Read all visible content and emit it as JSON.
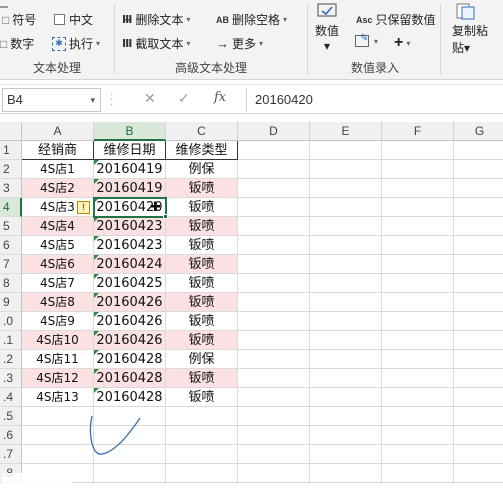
{
  "ribbon": {
    "row1": {
      "symbol": "符号",
      "chinese": "中文",
      "delete_text": "删除文本",
      "delete_spaces": "删除空格"
    },
    "row2": {
      "number": "数字",
      "execute": "执行",
      "extract_text": "截取文本",
      "more": "更多"
    },
    "numeric_btn": "数值",
    "keep_numeric": "只保留数值",
    "paste_line1": "复制粘",
    "paste_line2": "贴",
    "group_labels": [
      "文本处理",
      "高级文本处理",
      "数值录入"
    ],
    "asc_label": "Asc",
    "ab_label": "AB",
    "plus_label": "+"
  },
  "formula_bar": {
    "name_box": "B4",
    "cancel": "✕",
    "confirm": "✓",
    "fx": "fx",
    "content": "20160420"
  },
  "sheet": {
    "columns": [
      "A",
      "B",
      "C",
      "D",
      "E",
      "F",
      "G"
    ],
    "row_numbers": [
      "1",
      "2",
      "3",
      "4",
      "5",
      "6",
      "7",
      "8",
      "9",
      ".0",
      ".1",
      ".2",
      ".3",
      ".4",
      ".5",
      ".6",
      ".7",
      ".8"
    ],
    "header": [
      "经销商",
      "维修日期",
      "维修类型"
    ],
    "rows": [
      [
        "4S店1",
        "20160419",
        "例保"
      ],
      [
        "4S店2",
        "20160419",
        "钣喷"
      ],
      [
        "4S店3",
        "20160420",
        "钣喷"
      ],
      [
        "4S店4",
        "20160423",
        "钣喷"
      ],
      [
        "4S店5",
        "20160423",
        "钣喷"
      ],
      [
        "4S店6",
        "20160424",
        "钣喷"
      ],
      [
        "4S店7",
        "20160425",
        "钣喷"
      ],
      [
        "4S店8",
        "20160426",
        "钣喷"
      ],
      [
        "4S店9",
        "20160426",
        "钣喷"
      ],
      [
        "4S店10",
        "20160426",
        "钣喷"
      ],
      [
        "4S店11",
        "20160428",
        "例保"
      ],
      [
        "4S店12",
        "20160428",
        "钣喷"
      ],
      [
        "4S店13",
        "20160428",
        "钣喷"
      ]
    ],
    "selected_cell": "B4",
    "selected_col": "B",
    "selected_row": "4",
    "warning_symbol": "!",
    "colors": {
      "accent": "#217346",
      "pink": "#fbe1e1",
      "error_tri": "#2e8b3a"
    }
  }
}
